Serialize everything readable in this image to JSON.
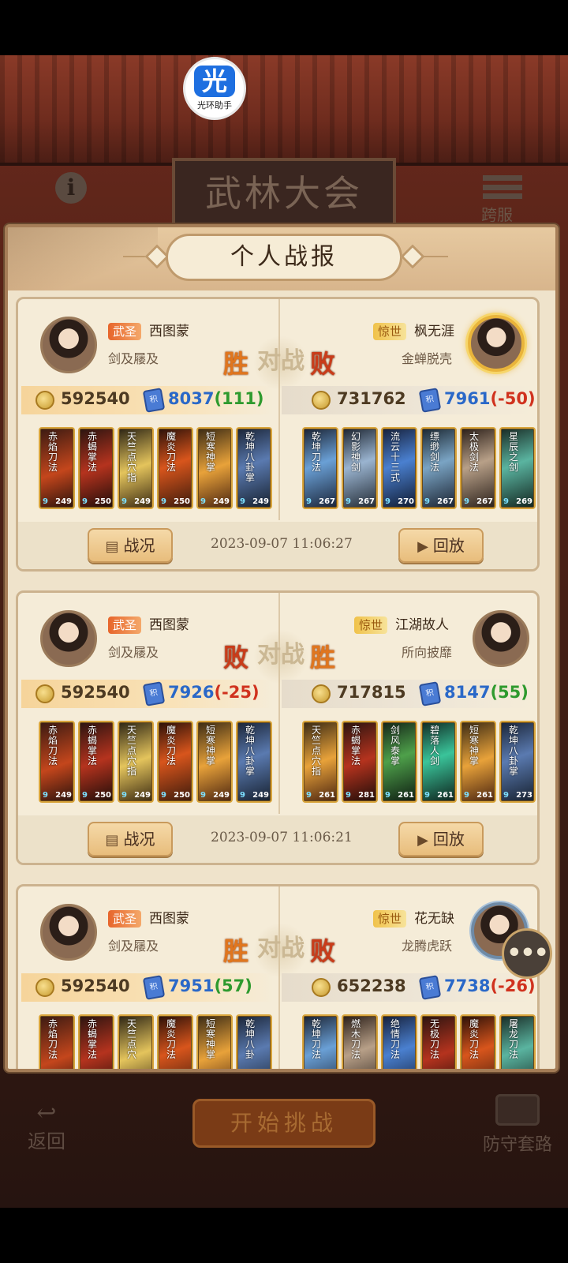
{
  "app_badge": {
    "glyph": "光",
    "label": "光环助手"
  },
  "header": {
    "board_title": "武林大会",
    "cross_server_label": "跨服"
  },
  "panel": {
    "title": "个人战报"
  },
  "battles": [
    {
      "left": {
        "rank": "武圣",
        "name": "西图蒙",
        "title": "剑及屦及",
        "power": "592540",
        "score": "8037",
        "delta": "(111)",
        "result": "胜"
      },
      "right": {
        "rank": "惊世",
        "name": "枫无涯",
        "title": "金蝉脱壳",
        "power": "731762",
        "score": "7961",
        "delta": "(-50)",
        "result": "败"
      },
      "vs_text": "对战",
      "left_skills": [
        {
          "name": "赤焰刀法",
          "level": "249"
        },
        {
          "name": "赤蝎掌法",
          "level": "250"
        },
        {
          "name": "天竺点穴指",
          "level": "249"
        },
        {
          "name": "魔炎刀法",
          "level": "250"
        },
        {
          "name": "短寒神掌",
          "level": "249"
        },
        {
          "name": "乾坤八卦掌",
          "level": "249"
        }
      ],
      "right_skills": [
        {
          "name": "乾坤刀法",
          "level": "267"
        },
        {
          "name": "幻影神剑",
          "level": "267"
        },
        {
          "name": "流云十三式",
          "level": "270"
        },
        {
          "name": "缥缈剑法",
          "level": "267"
        },
        {
          "name": "太极剑法",
          "level": "267"
        },
        {
          "name": "星辰之剑",
          "level": "269"
        }
      ],
      "report_label": "战况",
      "timestamp": "2023-09-07 11:06:27",
      "replay_label": "回放"
    },
    {
      "left": {
        "rank": "武圣",
        "name": "西图蒙",
        "title": "剑及屦及",
        "power": "592540",
        "score": "7926",
        "delta": "(-25)",
        "result": "败"
      },
      "right": {
        "rank": "惊世",
        "name": "江湖故人",
        "title": "所向披靡",
        "power": "717815",
        "score": "8147",
        "delta": "(55)",
        "result": "胜"
      },
      "vs_text": "对战",
      "left_skills": [
        {
          "name": "赤焰刀法",
          "level": "249"
        },
        {
          "name": "赤蝎掌法",
          "level": "250"
        },
        {
          "name": "天竺点穴指",
          "level": "249"
        },
        {
          "name": "魔炎刀法",
          "level": "250"
        },
        {
          "name": "短寒神掌",
          "level": "249"
        },
        {
          "name": "乾坤八卦掌",
          "level": "249"
        }
      ],
      "right_skills": [
        {
          "name": "天竺点穴指",
          "level": "261"
        },
        {
          "name": "赤蝎掌法",
          "level": "281"
        },
        {
          "name": "剑风泰掌",
          "level": "261"
        },
        {
          "name": "碧落人剑",
          "level": "261"
        },
        {
          "name": "短寒神掌",
          "level": "261"
        },
        {
          "name": "乾坤八卦掌",
          "level": "273"
        }
      ],
      "report_label": "战况",
      "timestamp": "2023-09-07 11:06:21",
      "replay_label": "回放"
    },
    {
      "left": {
        "rank": "武圣",
        "name": "西图蒙",
        "title": "剑及屦及",
        "power": "592540",
        "score": "7951",
        "delta": "(57)",
        "result": "胜"
      },
      "right": {
        "rank": "惊世",
        "name": "花无缺",
        "title": "龙腾虎跃",
        "power": "652238",
        "score": "7738",
        "delta": "(-26)",
        "result": "败"
      },
      "vs_text": "对战",
      "left_skills": [
        {
          "name": "赤焰刀法"
        },
        {
          "name": "赤蝎掌法"
        },
        {
          "name": "天竺点穴"
        },
        {
          "name": "魔炎刀法"
        },
        {
          "name": "短寒神掌"
        },
        {
          "name": "乾坤八卦"
        }
      ],
      "right_skills": [
        {
          "name": "乾坤刀法"
        },
        {
          "name": "燃木刀法"
        },
        {
          "name": "绝情刀法"
        },
        {
          "name": "无极刀法"
        },
        {
          "name": "魔炎刀法"
        },
        {
          "name": "屠龙刀法"
        }
      ]
    }
  ],
  "bottom": {
    "back_label": "返回",
    "start_label": "开始挑战",
    "defense_label": "防守套路"
  },
  "chat_bubble": "•••"
}
